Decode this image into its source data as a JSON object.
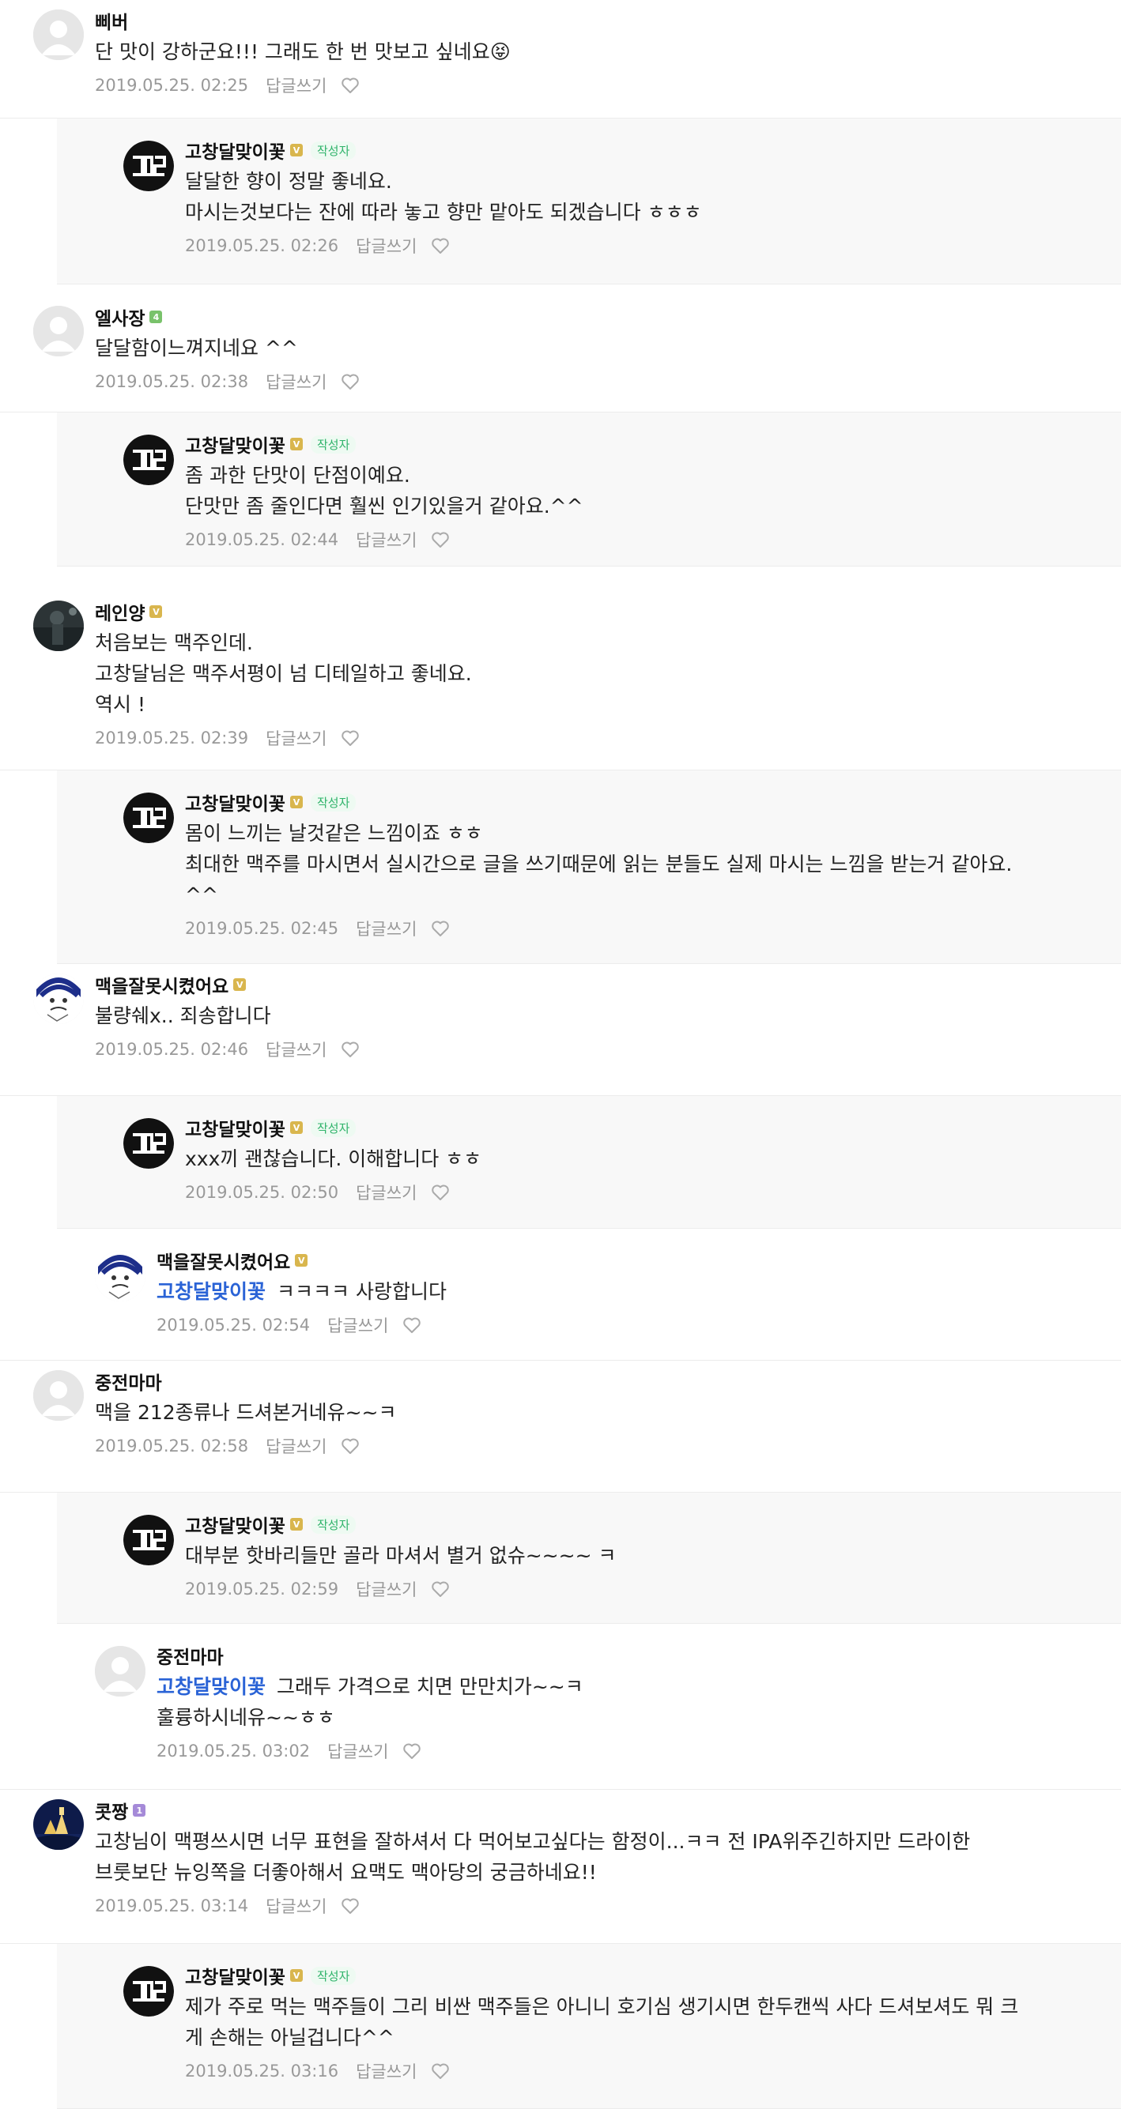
{
  "labels": {
    "author_tag": "작성자",
    "reply_btn": "답글쓰기"
  },
  "comments": [
    {
      "nick": "삐버",
      "grade": null,
      "avatar": "default",
      "reply": false,
      "mention": "",
      "text": "단 맛이 강하군요!!! 그래도 한 번 맛보고 싶네요😝",
      "date": "2019.05.25. 02:25"
    },
    {
      "nick": "고창달맞이꽃",
      "grade": "gold",
      "avatar": "logo",
      "author": true,
      "reply": true,
      "mention": "",
      "text": "달달한 향이 정말 좋네요.\n마시는것보다는 잔에 따라 놓고 향만 맡아도 되겠습니다 ㅎㅎㅎ",
      "date": "2019.05.25. 02:26"
    },
    {
      "nick": "엘사장",
      "grade": "green",
      "avatar": "default",
      "reply": false,
      "mention": "",
      "text": "달달함이느껴지네요 ^^",
      "date": "2019.05.25. 02:38"
    },
    {
      "nick": "고창달맞이꽃",
      "grade": "gold",
      "avatar": "logo",
      "author": true,
      "reply": true,
      "mention": "",
      "text": "좀 과한 단맛이 단점이예요.\n단맛만 좀 줄인다면 훨씬 인기있을거 같아요.^^",
      "date": "2019.05.25. 02:44"
    },
    {
      "nick": "레인양",
      "grade": "gold",
      "avatar": "photo-dark",
      "reply": false,
      "mention": "",
      "text": "처음보는 맥주인데.\n고창달님은 맥주서평이 넘 디테일하고 좋네요.\n역시 !",
      "date": "2019.05.25. 02:39"
    },
    {
      "nick": "고창달맞이꽃",
      "grade": "gold",
      "avatar": "logo",
      "author": true,
      "reply": true,
      "mention": "",
      "text": "몸이 느끼는 날것같은 느낌이죠 ㅎㅎ\n최대한 맥주를 마시면서 실시간으로 글을 쓰기때문에 읽는 분들도 실제 마시는 느낌을 받는거 같아요.\n^^",
      "date": "2019.05.25. 02:45"
    },
    {
      "nick": "맥을잘못시켰어요",
      "grade": "gold",
      "avatar": "sketch",
      "reply": false,
      "mention": "",
      "text": "불량쉐x.. 죄송합니다",
      "date": "2019.05.25. 02:46"
    },
    {
      "nick": "고창달맞이꽃",
      "grade": "gold",
      "avatar": "logo",
      "author": true,
      "reply": true,
      "mention": "",
      "text": "xxx끼 괜찮습니다. 이해합니다 ㅎㅎ",
      "date": "2019.05.25. 02:50"
    },
    {
      "nick": "맥을잘못시켰어요",
      "grade": "gold",
      "avatar": "sketch",
      "reply": true,
      "plain": true,
      "mention": "고창달맞이꽃",
      "text": "ㅋㅋㅋㅋ 사랑합니다",
      "date": "2019.05.25. 02:54"
    },
    {
      "nick": "중전마마",
      "grade": null,
      "avatar": "default",
      "reply": false,
      "mention": "",
      "text": "맥을 212종류나 드셔본거네유~~ㅋ",
      "date": "2019.05.25. 02:58"
    },
    {
      "nick": "고창달맞이꽃",
      "grade": "gold",
      "avatar": "logo",
      "author": true,
      "reply": true,
      "mention": "",
      "text": "대부분 핫바리들만 골라 마셔서 별거 없슈~~~~ ㅋ",
      "date": "2019.05.25. 02:59"
    },
    {
      "nick": "중전마마",
      "grade": null,
      "avatar": "default",
      "reply": true,
      "plain": true,
      "mention": "고창달맞이꽃",
      "text": "그래두 가격으로 치면 만만치가~~ㅋ\n훌륭하시네유~~ㅎㅎ",
      "date": "2019.05.25. 03:02"
    },
    {
      "nick": "콧짱",
      "grade": "purple",
      "avatar": "photo-night",
      "reply": false,
      "mention": "",
      "text": "고창님이 맥평쓰시면 너무 표현을 잘하셔서 다 먹어보고싶다는 함정이...ㅋㅋ 전 IPA위주긴하지만 드라이한\n브룻보단 뉴잉쪽을 더좋아해서 요맥도 맥아당의 궁금하네요!!",
      "date": "2019.05.25. 03:14"
    },
    {
      "nick": "고창달맞이꽃",
      "grade": "gold",
      "avatar": "logo",
      "author": true,
      "reply": true,
      "mention": "",
      "text": "제가 주로 먹는 맥주들이 그리 비싼 맥주들은 아니니 호기심 생기시면 한두캔씩 사다 드셔보셔도 뭐 크\n게 손해는 아닐겁니다^^",
      "date": "2019.05.25. 03:16"
    }
  ]
}
